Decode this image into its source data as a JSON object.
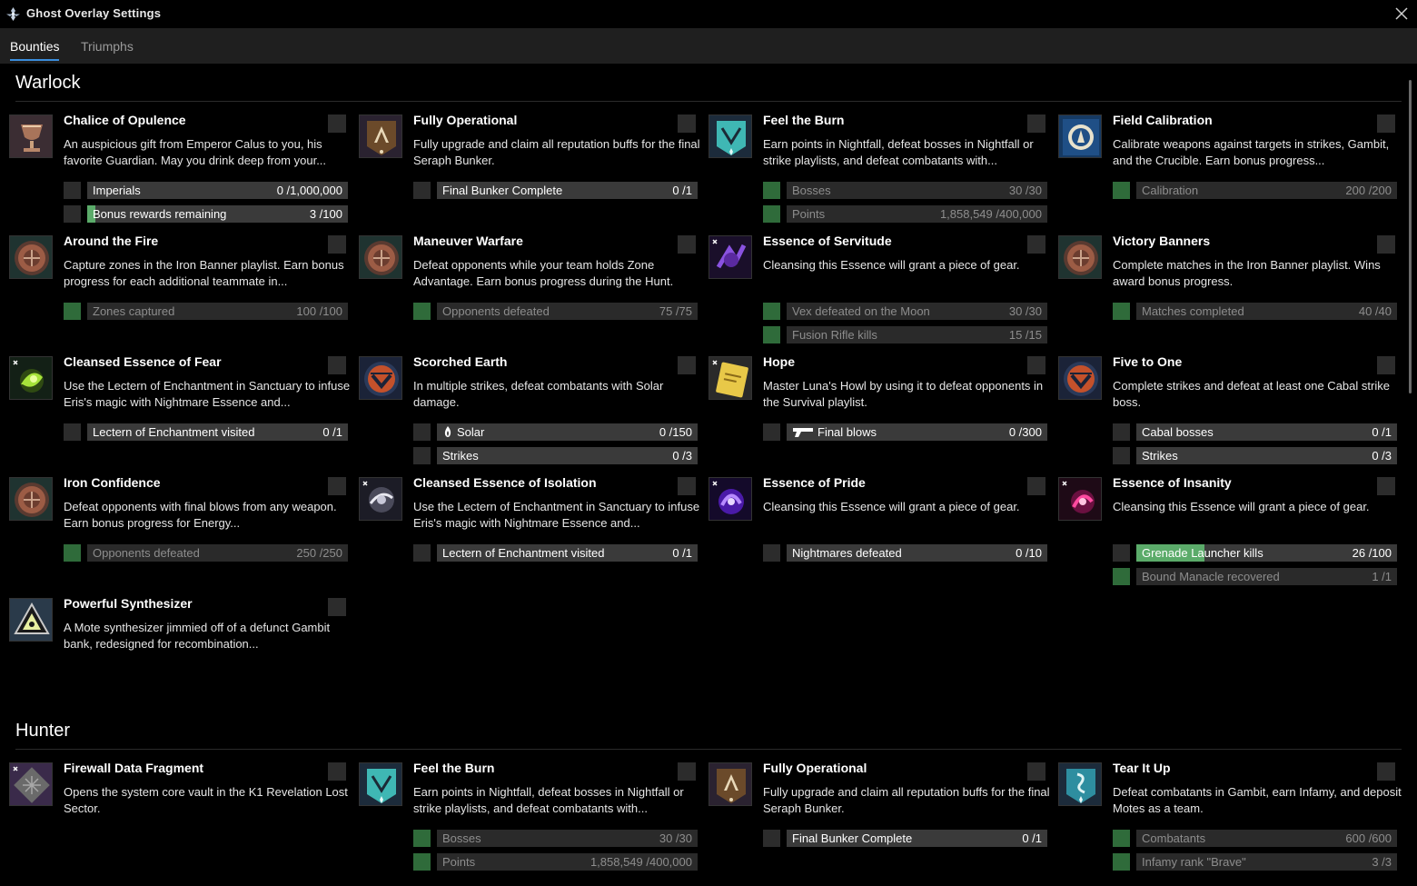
{
  "app": {
    "title": "Ghost Overlay Settings",
    "icon": "ghost-icon"
  },
  "tabs": [
    {
      "label": "Bounties",
      "active": true
    },
    {
      "label": "Triumphs",
      "active": false
    }
  ],
  "sections": [
    {
      "title": "Warlock",
      "cards": [
        {
          "title": "Chalice of Opulence",
          "icon": "chalice-icon",
          "desc": "An auspicious gift from Emperor Calus to you, his favorite Guardian. May you drink deep from your...",
          "objectives": [
            {
              "label": "Imperials",
              "value": "0 /1,000,000",
              "progress": 0,
              "complete": false
            },
            {
              "label": "Bonus rewards remaining",
              "value": "3 /100",
              "progress": 0.03,
              "complete": false
            }
          ]
        },
        {
          "title": "Fully Operational",
          "icon": "seraph-banner-icon",
          "desc": "Fully upgrade and claim all reputation buffs for the final Seraph Bunker.",
          "objectives": [
            {
              "label": "Final Bunker Complete",
              "value": "0 /1",
              "progress": 0,
              "complete": false
            }
          ]
        },
        {
          "title": "Feel the Burn",
          "icon": "nightfall-banner-icon",
          "desc": "Earn points in Nightfall, defeat bosses in Nightfall or strike playlists, and defeat combatants with...",
          "objectives": [
            {
              "label": "Bosses",
              "value": "30 /30",
              "progress": 1,
              "complete": true
            },
            {
              "label": "Points",
              "value": "1,858,549 /400,000",
              "progress": 1,
              "complete": true
            }
          ]
        },
        {
          "title": "Field Calibration",
          "icon": "calibration-icon",
          "desc": "Calibrate weapons against targets in strikes, Gambit, and the Crucible. Earn bonus progress...",
          "objectives": [
            {
              "label": "Calibration",
              "value": "200 /200",
              "progress": 1,
              "complete": true
            }
          ]
        },
        {
          "title": "Around the Fire",
          "icon": "iron-banner-icon",
          "desc": "Capture zones in the Iron Banner playlist. Earn bonus progress for each additional teammate in...",
          "objectives": [
            {
              "label": "Zones captured",
              "value": "100 /100",
              "progress": 1,
              "complete": true
            }
          ]
        },
        {
          "title": "Maneuver Warfare",
          "icon": "iron-banner-icon",
          "desc": "Defeat opponents while your team holds Zone Advantage. Earn bonus progress during the Hunt.",
          "objectives": [
            {
              "label": "Opponents defeated",
              "value": "75 /75",
              "progress": 1,
              "complete": true
            }
          ]
        },
        {
          "title": "Essence of Servitude",
          "icon": "essence-servitude-icon",
          "desc": "Cleansing this Essence will grant a piece of gear.",
          "objectives": [
            {
              "label": "Vex defeated on the Moon",
              "value": "30 /30",
              "progress": 1,
              "complete": true
            },
            {
              "label": "Fusion Rifle kills",
              "value": "15 /15",
              "progress": 1,
              "complete": true
            }
          ]
        },
        {
          "title": "Victory Banners",
          "icon": "iron-banner-icon",
          "desc": "Complete matches in the Iron Banner playlist. Wins award bonus progress.",
          "objectives": [
            {
              "label": "Matches completed",
              "value": "40 /40",
              "progress": 1,
              "complete": true
            }
          ]
        },
        {
          "title": "Cleansed Essence of Fear",
          "icon": "essence-fear-icon",
          "desc": "Use the Lectern of Enchantment in Sanctuary to infuse Eris's magic with Nightmare Essence and...",
          "objectives": [
            {
              "label": "Lectern of Enchantment visited",
              "value": "0 /1",
              "progress": 0,
              "complete": false
            }
          ]
        },
        {
          "title": "Scorched Earth",
          "icon": "vanguard-icon",
          "desc": "In multiple strikes, defeat combatants with Solar damage.",
          "objectives": [
            {
              "label": "Solar",
              "value": "0 /150",
              "progress": 0,
              "complete": false,
              "mini_icon": "solar-icon"
            },
            {
              "label": "Strikes",
              "value": "0 /3",
              "progress": 0,
              "complete": false
            }
          ]
        },
        {
          "title": "Hope",
          "icon": "hope-card-icon",
          "desc": "Master Luna's Howl by using it to defeat opponents in the Survival playlist.",
          "objectives": [
            {
              "label": "Final blows",
              "value": "0 /300",
              "progress": 0,
              "complete": false,
              "mini_icon": "hand-cannon-icon"
            }
          ]
        },
        {
          "title": "Five to One",
          "icon": "vanguard-icon",
          "desc": "Complete strikes and defeat at least one Cabal strike boss.",
          "objectives": [
            {
              "label": "Cabal bosses",
              "value": "0 /1",
              "progress": 0,
              "complete": false
            },
            {
              "label": "Strikes",
              "value": "0 /3",
              "progress": 0,
              "complete": false
            }
          ]
        },
        {
          "title": "Iron Confidence",
          "icon": "iron-banner-icon",
          "desc": "Defeat opponents with final blows from any weapon. Earn bonus progress for Energy...",
          "objectives": [
            {
              "label": "Opponents defeated",
              "value": "250 /250",
              "progress": 1,
              "complete": true
            }
          ]
        },
        {
          "title": "Cleansed Essence of Isolation",
          "icon": "essence-isolation-icon",
          "desc": "Use the Lectern of Enchantment in Sanctuary to infuse Eris's magic with Nightmare Essence and...",
          "objectives": [
            {
              "label": "Lectern of Enchantment visited",
              "value": "0 /1",
              "progress": 0,
              "complete": false
            }
          ]
        },
        {
          "title": "Essence of Pride",
          "icon": "essence-pride-icon",
          "desc": "Cleansing this Essence will grant a piece of gear.",
          "objectives": [
            {
              "label": "Nightmares defeated",
              "value": "0 /10",
              "progress": 0,
              "complete": false
            }
          ]
        },
        {
          "title": "Essence of Insanity",
          "icon": "essence-insanity-icon",
          "desc": "Cleansing this Essence will grant a piece of gear.",
          "objectives": [
            {
              "label": "Grenade Launcher kills",
              "value": "26 /100",
              "progress": 0.26,
              "complete": false
            },
            {
              "label": "Bound Manacle recovered",
              "value": "1 /1",
              "progress": 1,
              "complete": true
            }
          ]
        },
        {
          "title": "Powerful Synthesizer",
          "icon": "synthesizer-icon",
          "desc": "A Mote synthesizer jimmied off of a defunct Gambit bank, redesigned for recombination...",
          "objectives": []
        }
      ]
    },
    {
      "title": "Hunter",
      "cards": [
        {
          "title": "Firewall Data Fragment",
          "icon": "data-fragment-icon",
          "desc": "Opens the system core vault in the K1 Revelation Lost Sector.",
          "objectives": []
        },
        {
          "title": "Feel the Burn",
          "icon": "nightfall-banner-icon",
          "desc": "Earn points in Nightfall, defeat bosses in Nightfall or strike playlists, and defeat combatants with...",
          "objectives": [
            {
              "label": "Bosses",
              "value": "30 /30",
              "progress": 1,
              "complete": true
            },
            {
              "label": "Points",
              "value": "1,858,549 /400,000",
              "progress": 1,
              "complete": true
            }
          ]
        },
        {
          "title": "Fully Operational",
          "icon": "seraph-banner-icon",
          "desc": "Fully upgrade and claim all reputation buffs for the final Seraph Bunker.",
          "objectives": [
            {
              "label": "Final Bunker Complete",
              "value": "0 /1",
              "progress": 0,
              "complete": false
            }
          ]
        },
        {
          "title": "Tear It Up",
          "icon": "gambit-banner-icon",
          "desc": "Defeat combatants in Gambit, earn Infamy, and deposit Motes as a team.",
          "objectives": [
            {
              "label": "Combatants",
              "value": "600 /600",
              "progress": 1,
              "complete": true
            },
            {
              "label": "Infamy rank \"Brave\"",
              "value": "3 /3",
              "progress": 1,
              "complete": true
            }
          ]
        }
      ]
    }
  ],
  "colors": {
    "accent": "#3a8ddc",
    "complete": "#2f6b3a",
    "fill": "#5bab6a",
    "tabbar": "#1f1f1f"
  }
}
